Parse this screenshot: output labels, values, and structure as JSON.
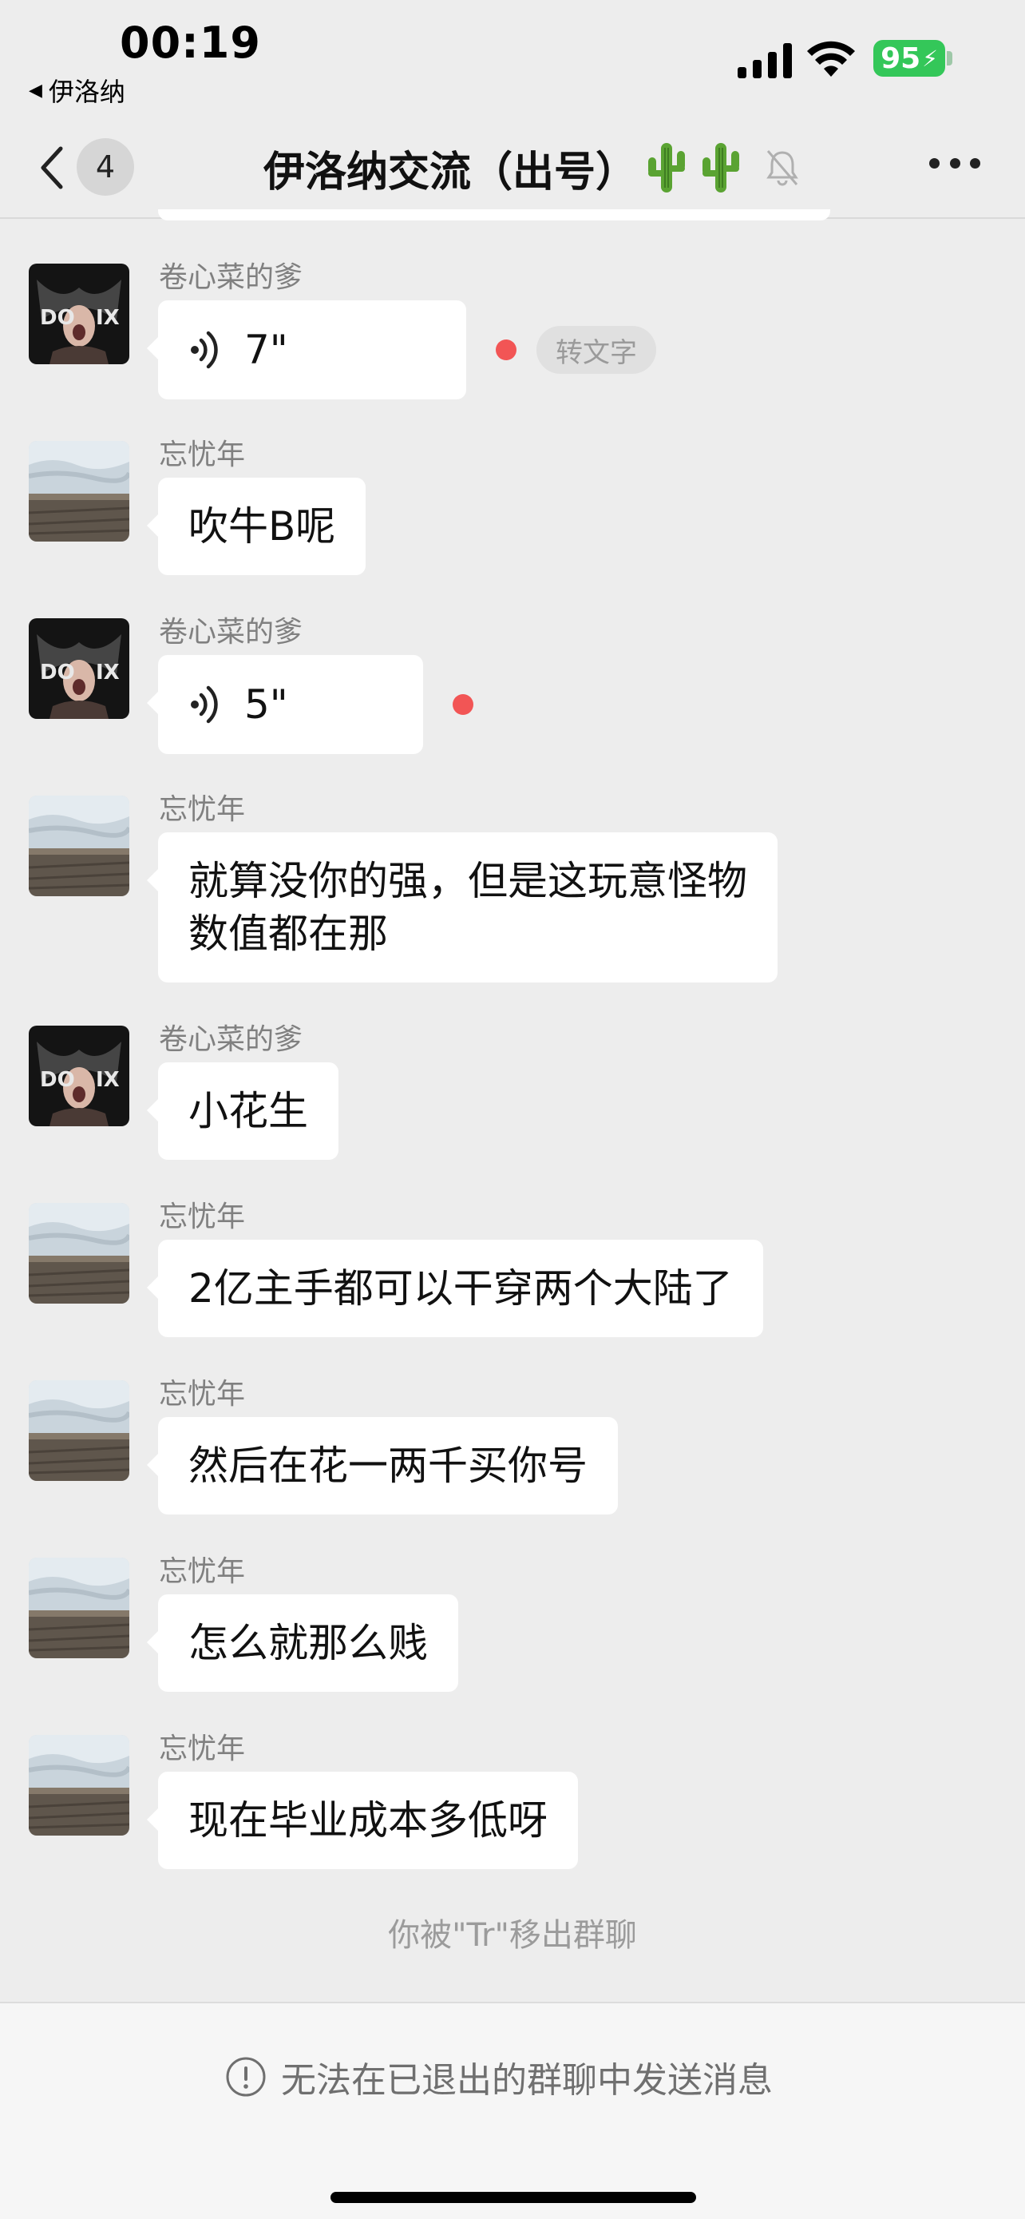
{
  "status_bar": {
    "time": "00:19",
    "back_app": "伊洛纳",
    "battery_level": "95"
  },
  "nav": {
    "badge_count": "4",
    "title": "伊洛纳交流（出号）",
    "title_emoji": "cactus-icon"
  },
  "messages": [
    {
      "sender": "卷心菜的爹",
      "type": "voice",
      "duration": "7\"",
      "unread": true,
      "transcribe_label": "转文字"
    },
    {
      "sender": "忘忧年",
      "type": "text",
      "text": "吹牛B呢"
    },
    {
      "sender": "卷心菜的爹",
      "type": "voice",
      "duration": "5\"",
      "unread": true
    },
    {
      "sender": "忘忧年",
      "type": "text",
      "lines": [
        "就算没你的强，但是这玩意怪物",
        "数值都在那"
      ]
    },
    {
      "sender": "卷心菜的爹",
      "type": "text",
      "text": "小花生"
    },
    {
      "sender": "忘忧年",
      "type": "text",
      "text": "2亿主手都可以干穿两个大陆了"
    },
    {
      "sender": "忘忧年",
      "type": "text",
      "text": "然后在花一两千买你号"
    },
    {
      "sender": "忘忧年",
      "type": "text",
      "text": "怎么就那么贱"
    },
    {
      "sender": "忘忧年",
      "type": "text",
      "text": "现在毕业成本多低呀"
    }
  ],
  "system_notice": "你被\"Tr\"移出群聊",
  "bottom_notice": "无法在已退出的群聊中发送消息",
  "colors": {
    "background": "#ededed",
    "bubble": "#ffffff",
    "unread_dot": "#f25555",
    "battery": "#34c759"
  }
}
